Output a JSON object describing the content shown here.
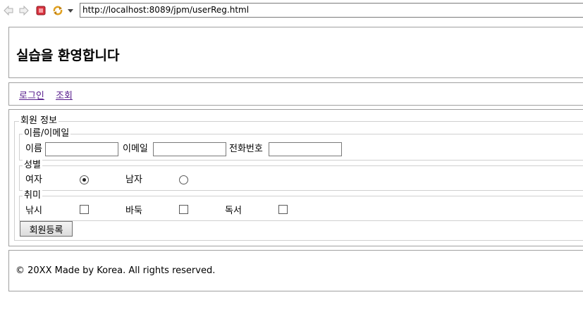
{
  "browser": {
    "url": "http://localhost:8089/jpm/userReg.html"
  },
  "header": {
    "title": "실습을 환영합니다"
  },
  "nav": {
    "login": "로그인",
    "lookup": "조회"
  },
  "form": {
    "legend": "회원 정보",
    "name_email": {
      "legend": "이름/이메일",
      "name_label": "이름",
      "email_label": "이메일",
      "phone_label": "전화번호"
    },
    "gender": {
      "legend": "성별",
      "female_label": "여자",
      "male_label": "남자",
      "selected": "여자"
    },
    "hobby": {
      "legend": "취미",
      "fishing_label": "낚시",
      "baduk_label": "바둑",
      "reading_label": "독서"
    },
    "submit_label": "회원등록"
  },
  "footer": {
    "text": "© 20XX Made by Korea. All rights reserved."
  },
  "colors": {
    "visited_link": "#551a8b",
    "border": "#a0a0a0"
  }
}
